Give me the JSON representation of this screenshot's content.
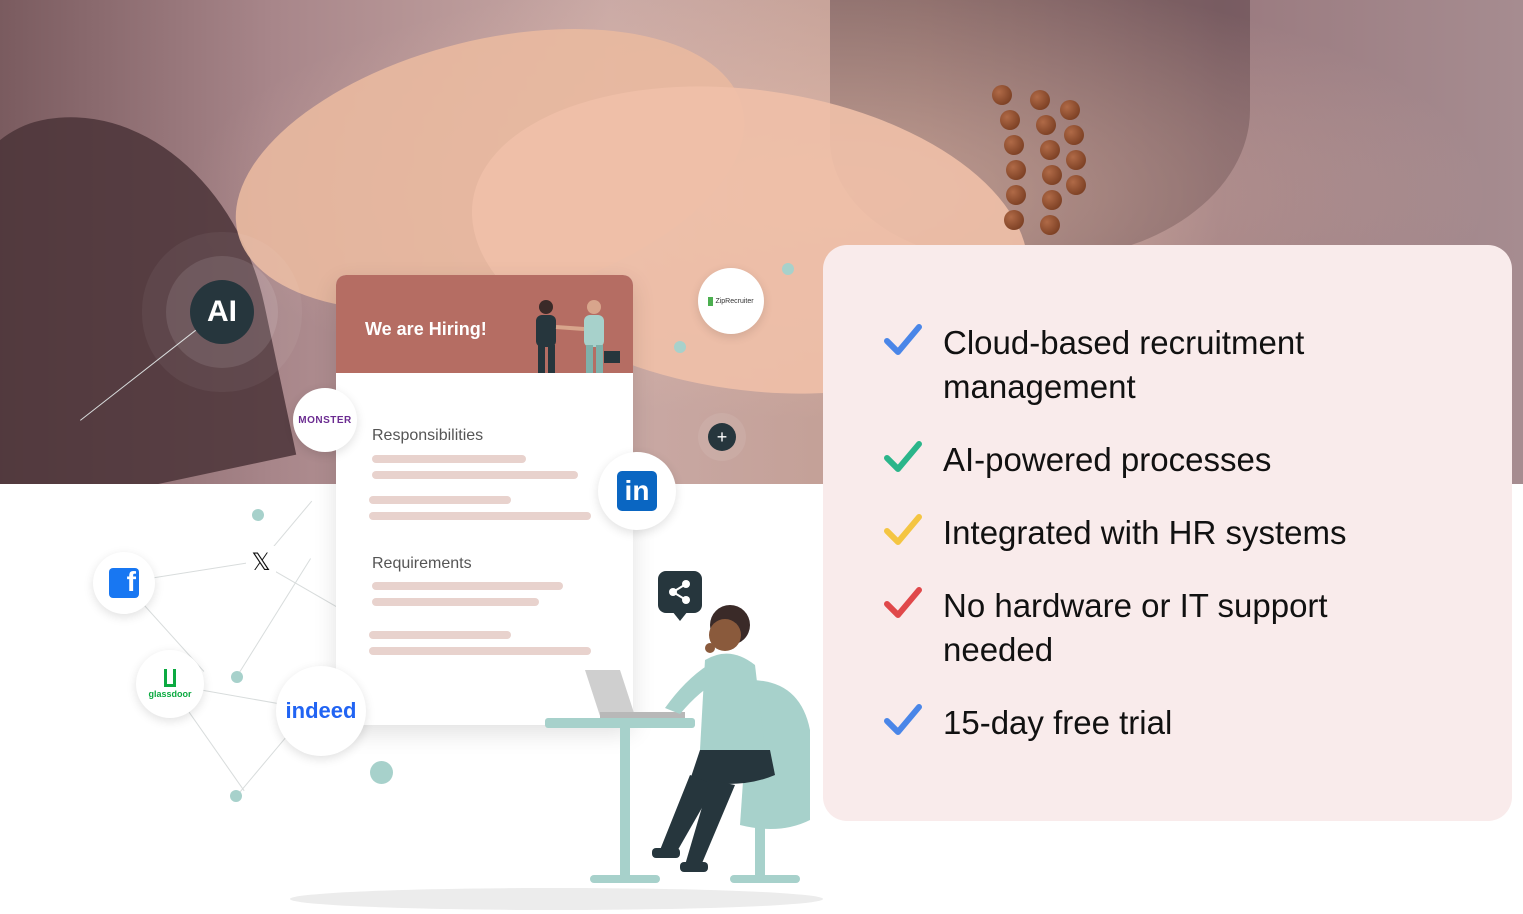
{
  "hero": {
    "ai_badge": "AI",
    "job_card": {
      "title": "We are Hiring!",
      "section1": "Responsibilities",
      "section2": "Requirements"
    },
    "brands": {
      "monster": "MONSTER",
      "ziprecruiter": "ZipRecruiter",
      "linkedin": "in",
      "indeed": "indeed",
      "glassdoor": "glassdoor",
      "x": "𝕏",
      "facebook": "f"
    },
    "plus_symbol": "+"
  },
  "features": [
    {
      "text_line1": "Cloud-based recruitment",
      "text_line2": "management",
      "check_color": "#4a86e8"
    },
    {
      "text_line1": "AI-powered processes",
      "text_line2": "",
      "check_color": "#2bb58a"
    },
    {
      "text_line1": "Integrated with HR systems",
      "text_line2": "",
      "check_color": "#f4c542"
    },
    {
      "text_line1": "No hardware or IT support",
      "text_line2": "needed",
      "check_color": "#e0484a"
    },
    {
      "text_line1": "15-day free trial",
      "text_line2": "",
      "check_color": "#4a86e8"
    }
  ],
  "colors": {
    "card_header": "#b56d63",
    "panel_bg": "#f9ebeb",
    "dark_badge": "#26363d",
    "accent_teal": "#a7d1cb"
  }
}
